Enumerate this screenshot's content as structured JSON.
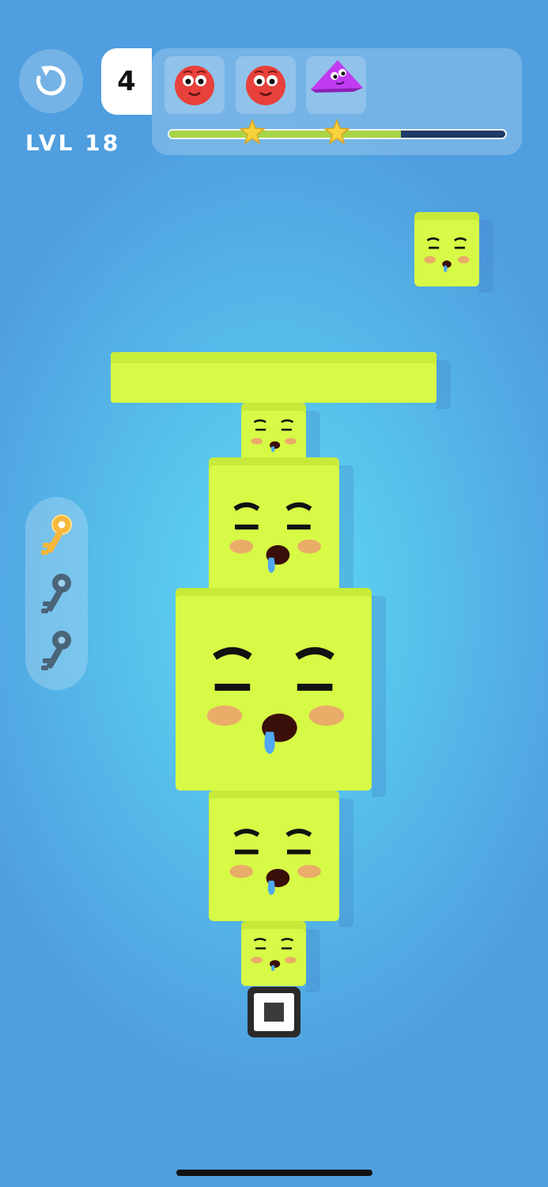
{
  "hud": {
    "level_label": "LVL 18",
    "moves_left": "4",
    "progress": 0.69,
    "stars_earned": 2,
    "goal_icons": [
      "red-round-face-icon",
      "red-round-face-icon",
      "purple-triangle-face-icon"
    ]
  },
  "keys": {
    "collected": 1,
    "total": 3,
    "icons": [
      "gold-key-icon",
      "gray-key-icon",
      "gray-key-icon"
    ]
  },
  "colors": {
    "block": "#d7fa46",
    "background_center": "#5fdaf3",
    "background_edge": "#4f9edf",
    "goal_red": "#e8403a",
    "goal_purple": "#c13bf0",
    "progress_fill": "#a8d445",
    "progress_track": "#1e3a66",
    "key_gold": "#f6b73c",
    "key_gray": "#4a6478"
  }
}
